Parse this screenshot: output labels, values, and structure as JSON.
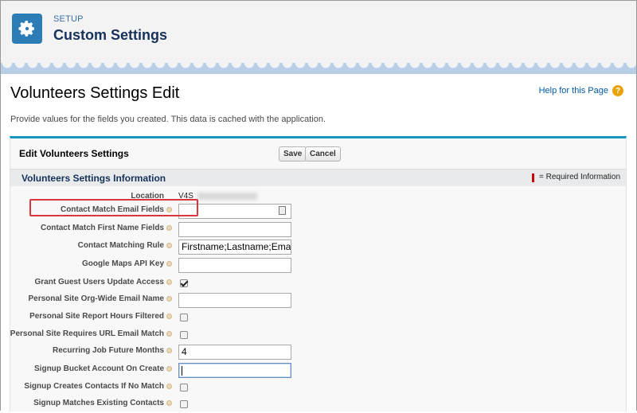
{
  "header": {
    "eyebrow": "SETUP",
    "title": "Custom Settings",
    "icon": "gear-icon"
  },
  "page": {
    "title": "Volunteers Settings Edit",
    "help_link": "Help for this Page",
    "description": "Provide values for the fields you created. This data is cached with the application."
  },
  "block": {
    "title": "Edit Volunteers Settings",
    "save_label": "Save",
    "cancel_label": "Cancel",
    "section_title": "Volunteers Settings Information",
    "required_legend": "= Required Information"
  },
  "fields": {
    "location": {
      "label": "Location",
      "value": "V4S"
    },
    "contact_match_email": {
      "label": "Contact Match Email Fields",
      "value": ""
    },
    "contact_match_first_name": {
      "label": "Contact Match First Name Fields",
      "value": ""
    },
    "contact_matching_rule": {
      "label": "Contact Matching Rule",
      "value": "Firstname;Lastname;Email"
    },
    "google_maps_api_key": {
      "label": "Google Maps API Key",
      "value": ""
    },
    "grant_guest_users": {
      "label": "Grant Guest Users Update Access",
      "checked": true
    },
    "personal_site_org_wide_email": {
      "label": "Personal Site Org-Wide Email Name",
      "value": ""
    },
    "personal_site_report_hours": {
      "label": "Personal Site Report Hours Filtered",
      "checked": false
    },
    "personal_site_requires_url": {
      "label": "Personal Site Requires URL Email Match",
      "checked": false
    },
    "recurring_job_future_months": {
      "label": "Recurring Job Future Months",
      "value": "4"
    },
    "signup_bucket_account": {
      "label": "Signup Bucket Account On Create",
      "value": ""
    },
    "signup_creates_contacts": {
      "label": "Signup Creates Contacts If No Match",
      "checked": false
    },
    "signup_matches_existing": {
      "label": "Signup Matches Existing Contacts",
      "checked": false
    }
  },
  "colors": {
    "header_icon_bg": "#2c7cb5",
    "block_accent": "#1797c0",
    "highlight_border": "#d9363e",
    "required_marker": "#cc0000"
  }
}
